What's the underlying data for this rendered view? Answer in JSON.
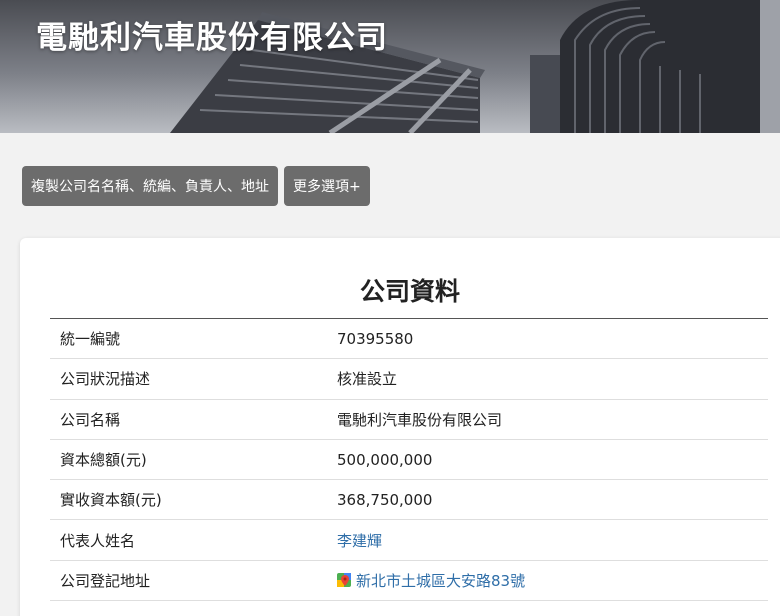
{
  "header": {
    "title": "電馳利汽車股份有限公司"
  },
  "toolbar": {
    "copy_button_label": "複製公司名名稱、統編、負責人、地址",
    "more_options_label": "更多選項+"
  },
  "company_card": {
    "title": "公司資料",
    "rows": [
      {
        "label": "統一編號",
        "value": "70395580"
      },
      {
        "label": "公司狀況描述",
        "value": "核准設立"
      },
      {
        "label": "公司名稱",
        "value": "電馳利汽車股份有限公司"
      },
      {
        "label": "資本總額(元)",
        "value": "500,000,000"
      },
      {
        "label": "實收資本額(元)",
        "value": "368,750,000"
      },
      {
        "label": "代表人姓名",
        "value": "李建輝"
      },
      {
        "label": "公司登記地址",
        "value": "新北市土城區大安路83號"
      }
    ]
  },
  "icons": {
    "address_icon": "google-maps-pin-icon"
  },
  "colors": {
    "link": "#2f6ea8",
    "button_bg": "#6c6c6c"
  }
}
